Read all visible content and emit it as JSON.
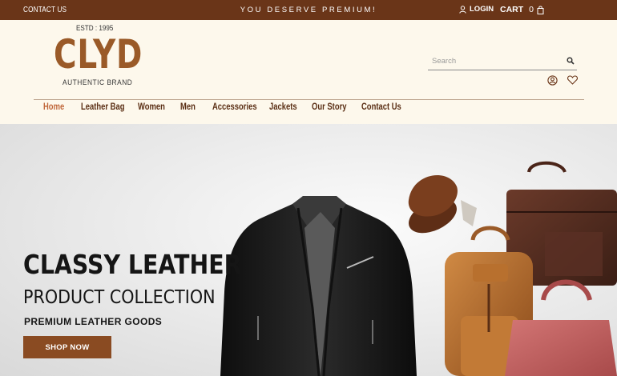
{
  "topbar": {
    "contact_label": "CONTACT US",
    "tagline": "YOU DESERVE PREMIUM!",
    "login_label": "LOGIN",
    "cart_label": "CART",
    "cart_count": "0"
  },
  "brand": {
    "estd": "ESTD : 1995",
    "logo": "CLYD",
    "tagline": "AUTHENTIC BRAND"
  },
  "search": {
    "placeholder": "Search"
  },
  "nav": {
    "items": [
      "Home",
      "Leather Bag",
      "Women",
      "Men",
      "Accessories",
      "Jackets",
      "Our Story",
      "Contact Us"
    ],
    "active": "Home"
  },
  "hero": {
    "title_line1": "CLASSY LEATHER",
    "title_line2": "PRODUCT COLLECTION",
    "subtitle": "PREMIUM LEATHER GOODS",
    "cta_label": "SHOP NOW"
  },
  "icons": {
    "login": "user-icon",
    "cart": "shopping-bag-icon",
    "search": "search-icon",
    "account": "user-circle-icon",
    "wishlist": "heart-icon"
  },
  "colors": {
    "topbar_bg": "#6a3518",
    "header_bg": "#fdf8ec",
    "brand_brown": "#9a5a28",
    "nav_active": "#c0673a",
    "cta_bg": "#8a4b22"
  }
}
